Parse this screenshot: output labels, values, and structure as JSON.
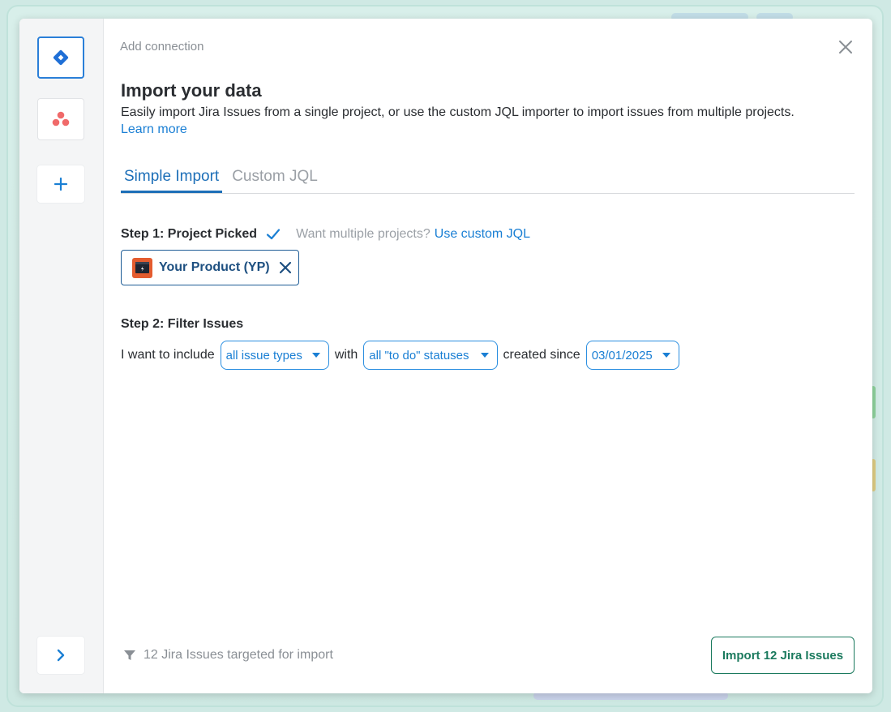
{
  "rail": {
    "items": [
      {
        "name": "jira",
        "icon": "jira-diamond-icon",
        "active": true
      },
      {
        "name": "asana",
        "icon": "asana-dots-icon",
        "active": false
      },
      {
        "name": "add",
        "icon": "plus-icon",
        "active": false
      }
    ],
    "expand_icon": "chevron-right-icon"
  },
  "header": {
    "label": "Add connection",
    "close_icon": "close-icon"
  },
  "main": {
    "title": "Import your data",
    "description": "Easily import Jira Issues from a single project, or use the custom JQL importer to import issues from multiple projects.",
    "learn_more": "Learn more",
    "tabs": [
      {
        "label": "Simple Import",
        "active": true
      },
      {
        "label": "Custom JQL",
        "active": false
      }
    ],
    "step1": {
      "label": "Step 1: Project Picked",
      "hint": "Want multiple projects?",
      "link": "Use custom JQL",
      "project_chip": "Your Product (YP)"
    },
    "step2": {
      "label": "Step 2: Filter Issues",
      "prefix": "I want to include",
      "issue_types": "all issue types",
      "with": "with",
      "statuses": "all \"to do\" statuses",
      "created_since_label": "created since",
      "date": "03/01/2025"
    }
  },
  "footer": {
    "info": "12 Jira Issues targeted for import",
    "import_button": "Import 12 Jira Issues"
  },
  "colors": {
    "accent": "#1a7fd4",
    "primary_dark": "#1d4f80",
    "import_green": "#1b7a5e",
    "asana_red": "#f06a6a"
  }
}
